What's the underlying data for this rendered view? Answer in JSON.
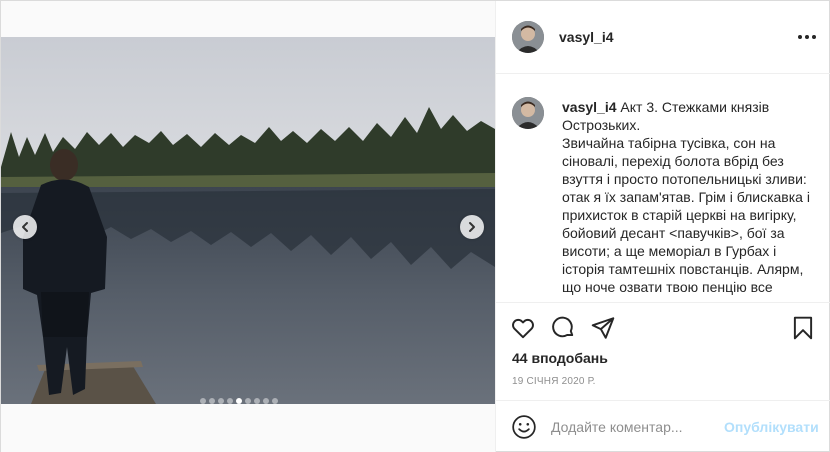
{
  "post": {
    "username": "vasyl_i4",
    "caption_username": "vasyl_i4",
    "caption_text": "Акт 3. Стежками князів Острозьких.\nЗвичайна табірна тусівка, сон на сіновалі, перехід болота вбрід без взуття і просто потопельницькі зливи: отак я їх запам'ятав. Грім і блискавка і прихисток в старій церкві на вигірку, бойовий десант <павучків>, бої за висоти; а ще меморіал в Гурбах і історія тамтешніх повстанців. Алярм, що ноче озвати твою пенцію все",
    "likes": "44 вподобань",
    "date": "19 СІЧНЯ 2020 Р.",
    "carousel": {
      "total_slides": 9,
      "active_index": 4
    }
  },
  "comment_box": {
    "placeholder": "Додайте коментар...",
    "publish_label": "Опублікувати"
  },
  "icons": {
    "more": "more-options-icon",
    "like": "heart-icon",
    "comment": "comment-icon",
    "share": "share-icon",
    "save": "bookmark-icon",
    "emoji": "emoji-icon",
    "prev": "chevron-left-icon",
    "next": "chevron-right-icon"
  },
  "colors": {
    "publish_disabled": "#b2dffc",
    "meta_gray": "#8e8e8e",
    "text": "#262626",
    "border": "#dbdbdb"
  }
}
